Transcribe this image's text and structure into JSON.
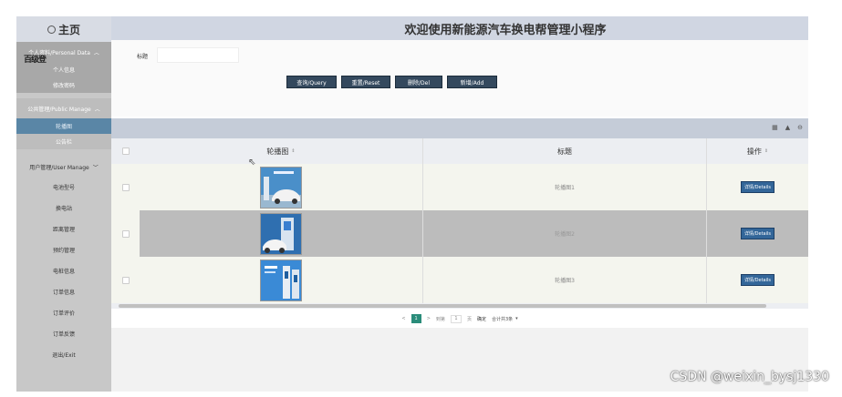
{
  "sidebar": {
    "home_label": "主页",
    "groups": [
      {
        "label": "个人资料/Personal Data",
        "items": [
          "个人信息",
          "修改密码"
        ]
      },
      {
        "label": "公共管理/Public Manage",
        "items": [
          "轮播图",
          "公告栏"
        ]
      },
      {
        "label": "用户管理/User Manage",
        "items": [
          "电池型号",
          "换电站",
          "距离管理",
          "预约管理",
          "电桩信息",
          "订单信息",
          "订单评价",
          "订单反馈",
          "退出/Exit"
        ]
      }
    ],
    "overlay_text": "百级登"
  },
  "header": {
    "title": "欢迎使用新能源汽车换电帮管理小程序"
  },
  "search": {
    "label": "标题",
    "value": "",
    "placeholder": ""
  },
  "buttons": {
    "query": "查询/Query",
    "reset": "重置/Reset",
    "delete": "删除/Del",
    "add": "新增/Add"
  },
  "toolbar_icons": [
    "columns-icon",
    "print-icon",
    "export-icon"
  ],
  "table": {
    "headers": {
      "image": "轮播图",
      "title": "标题",
      "ops": "操作"
    },
    "rows": [
      {
        "title": "轮播图1",
        "action": "详情/Details"
      },
      {
        "title": "轮播图2",
        "action": "详情/Details"
      },
      {
        "title": "轮播图3",
        "action": "详情/Details"
      }
    ]
  },
  "pager": {
    "prev": "<",
    "current": "1",
    "next": ">",
    "goto": "到第",
    "page_value": "1",
    "page_unit": "页",
    "confirm": "确定",
    "total": "合计共3条"
  },
  "watermark": "CSDN @weixin_bysj1330",
  "colors": {
    "accent": "#34495e",
    "active": "#5a86a6",
    "pager": "#2a8c7a",
    "detail": "#336699"
  }
}
